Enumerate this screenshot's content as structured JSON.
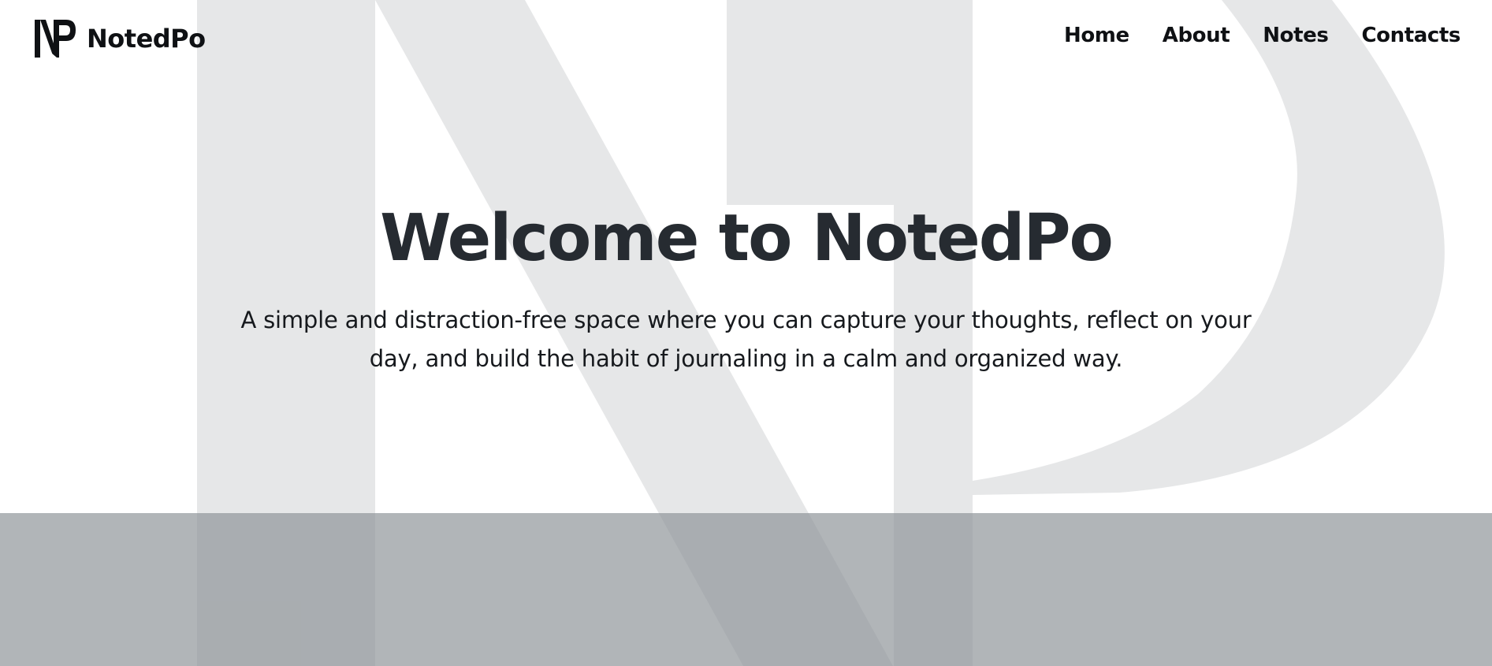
{
  "header": {
    "brand": "NotedPo",
    "nav": [
      {
        "label": "Home"
      },
      {
        "label": "About"
      },
      {
        "label": "Notes"
      },
      {
        "label": "Contacts"
      }
    ]
  },
  "hero": {
    "title": "Welcome to NotedPo",
    "subtitle": "A simple and distraction-free space where you can capture your thoughts, reflect on your day, and build the habit of journaling in a calm and organized way."
  },
  "theme": {
    "watermark_color": "#e6e7e8",
    "band_color": "#b1b5b8",
    "text_color": "#262b31"
  },
  "icons": {
    "logo": "np-logo-icon",
    "watermark": "np-watermark"
  }
}
